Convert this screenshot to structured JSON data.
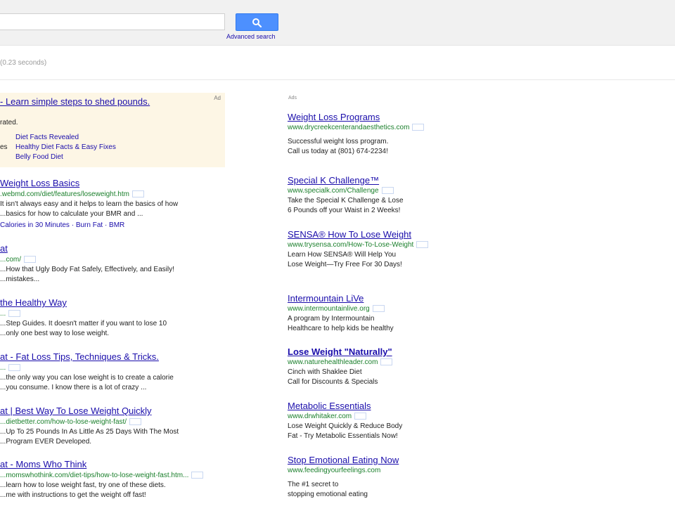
{
  "search": {
    "query": "",
    "button_icon": "magnifier-icon",
    "advanced_label": "Advanced search"
  },
  "stats": "(0.23 seconds)",
  "top_ad": {
    "ad_label": "Ad",
    "title": "- Learn simple steps to shed pounds.",
    "line": "rated.",
    "rows": [
      {
        "left": "",
        "link": "Diet Facts Revealed"
      },
      {
        "left": "es",
        "link": "Healthy Diet Facts & Easy Fixes"
      },
      {
        "left": "",
        "link": "Belly Food Diet"
      }
    ]
  },
  "results": [
    {
      "title": "Weight Loss Basics",
      "url": "www.webmd.com/diet/features/weight-loss-basics",
      "url_visible": ".webmd.com/diet/features/loseweight.htm",
      "snippet": [
        "It isn't always easy and it helps to learn the basics of how",
        "...basics for how to calculate your BMR and ..."
      ],
      "sublinks": "Calories in 30 Minutes · Burn Fat · BMR"
    },
    {
      "title": "at",
      "url_visible": "...com/",
      "snippet": [
        "...How that Ugly Body Fat Safely, Effectively, and Easily!",
        "...mistakes..."
      ]
    },
    {
      "title": "the Healthy Way",
      "url_visible": "...",
      "snippet": [
        "...Step Guides. It doesn't matter if you want to lose 10",
        "...only one best way to lose weight."
      ]
    },
    {
      "title": "at - Fat Loss Tips, Techniques & Tricks.",
      "url_visible": "...",
      "snippet": [
        "...the only way you can lose weight is to create a calorie",
        "...you consume. I know there is a lot of crazy ..."
      ]
    },
    {
      "title": "at | Best Way To Lose Weight Quickly",
      "url_visible": "...dietbetter.com/how-to-lose-weight-fast/",
      "snippet": [
        "...Up To 25 Pounds In As Little As 25 Days With The Most",
        "...Program EVER Developed."
      ]
    },
    {
      "title": "at - Moms Who Think",
      "url_visible": "...momswhothink.com/diet-tips/how-to-lose-weight-fast.htm...",
      "snippet": [
        "...learn how to lose weight fast, try one of these diets.",
        "...me with instructions to get the weight off fast!"
      ]
    }
  ],
  "right_ads_label": "Ads",
  "right_ads": [
    {
      "title": "Weight Loss Programs",
      "url": "www.drycreekcenterandaesthetics.com",
      "desc": [
        "Successful weight loss program.",
        "Call us today at (801) 674-2234!"
      ]
    },
    {
      "title": "Special K Challenge™",
      "url": "www.specialk.com/Challenge",
      "desc": [
        "Take the Special K Challenge & Lose",
        "6 Pounds off your Waist in 2 Weeks!"
      ]
    },
    {
      "title": "SENSA® How To Lose Weight",
      "url": "www.trysensa.com/How-To-Lose-Weight",
      "desc": [
        "Learn How SENSA® Will Help You",
        "Lose Weight—Try Free For 30 Days!"
      ]
    },
    {
      "title": "Intermountain LiVe",
      "url": "www.intermountainlive.org",
      "desc": [
        "A program by Intermountain",
        "Healthcare to help kids be healthy"
      ]
    },
    {
      "title": "Lose Weight \"Naturally\"",
      "url": "www.naturehealthleader.com",
      "desc": [
        "Cinch with Shaklee Diet",
        "Call for Discounts & Specials"
      ]
    },
    {
      "title": "Metabolic Essentials",
      "url": "www.drwhitaker.com",
      "desc": [
        "Lose Weight Quickly & Reduce Body",
        "Fat - Try Metabolic Essentials Now!"
      ]
    },
    {
      "title": "Stop Emotional Eating Now",
      "url": "www.feedingyourfeelings.com",
      "desc": [
        "The #1 secret to",
        "stopping emotional eating"
      ]
    }
  ]
}
